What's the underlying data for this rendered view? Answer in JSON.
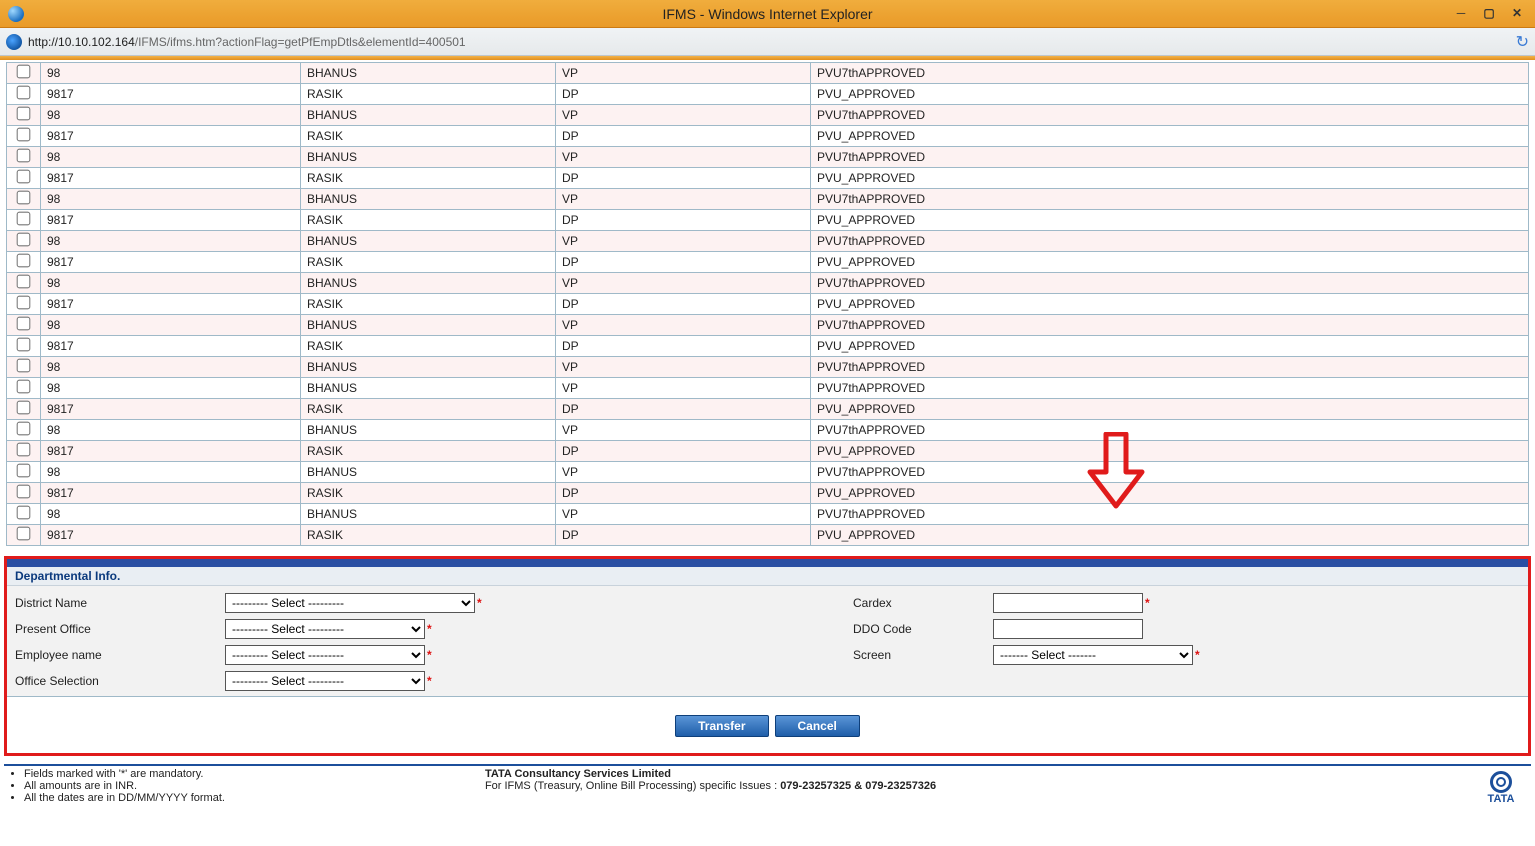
{
  "window": {
    "title": "IFMS - Windows Internet Explorer",
    "url_host": "http://10.10.102.164",
    "url_path": "/IFMS/ifms.htm?actionFlag=getPfEmpDtls&elementId=400501"
  },
  "table": {
    "rows": [
      {
        "c1": "98",
        "c2": "BHANUS",
        "c3": "VP",
        "c4": "PVU7thAPPROVED",
        "alt": true
      },
      {
        "c1": "9817",
        "c2": "RASIK",
        "c3": "DP",
        "c4": "PVU_APPROVED",
        "alt": false
      },
      {
        "c1": "98",
        "c2": "BHANUS",
        "c3": "VP",
        "c4": "PVU7thAPPROVED",
        "alt": true
      },
      {
        "c1": "9817",
        "c2": "RASIK",
        "c3": "DP",
        "c4": "PVU_APPROVED",
        "alt": false
      },
      {
        "c1": "98",
        "c2": "BHANUS",
        "c3": "VP",
        "c4": "PVU7thAPPROVED",
        "alt": true
      },
      {
        "c1": "9817",
        "c2": "RASIK",
        "c3": "DP",
        "c4": "PVU_APPROVED",
        "alt": false
      },
      {
        "c1": "98",
        "c2": "BHANUS",
        "c3": "VP",
        "c4": "PVU7thAPPROVED",
        "alt": true
      },
      {
        "c1": "9817",
        "c2": "RASIK",
        "c3": "DP",
        "c4": "PVU_APPROVED",
        "alt": false
      },
      {
        "c1": "98",
        "c2": "BHANUS",
        "c3": "VP",
        "c4": "PVU7thAPPROVED",
        "alt": true
      },
      {
        "c1": "9817",
        "c2": "RASIK",
        "c3": "DP",
        "c4": "PVU_APPROVED",
        "alt": false
      },
      {
        "c1": "98",
        "c2": "BHANUS",
        "c3": "VP",
        "c4": "PVU7thAPPROVED",
        "alt": true
      },
      {
        "c1": "9817",
        "c2": "RASIK",
        "c3": "DP",
        "c4": "PVU_APPROVED",
        "alt": false
      },
      {
        "c1": "98",
        "c2": "BHANUS",
        "c3": "VP",
        "c4": "PVU7thAPPROVED",
        "alt": true
      },
      {
        "c1": "9817",
        "c2": "RASIK",
        "c3": "DP",
        "c4": "PVU_APPROVED",
        "alt": false
      },
      {
        "c1": "98",
        "c2": "BHANUS",
        "c3": "VP",
        "c4": "PVU7thAPPROVED",
        "alt": true
      },
      {
        "c1": "98",
        "c2": "BHANUS",
        "c3": "VP",
        "c4": "PVU7thAPPROVED",
        "alt": false
      },
      {
        "c1": "9817",
        "c2": "RASIK",
        "c3": "DP",
        "c4": "PVU_APPROVED",
        "alt": true
      },
      {
        "c1": "98",
        "c2": "BHANUS",
        "c3": "VP",
        "c4": "PVU7thAPPROVED",
        "alt": false
      },
      {
        "c1": "9817",
        "c2": "RASIK",
        "c3": "DP",
        "c4": "PVU_APPROVED",
        "alt": true
      },
      {
        "c1": "98",
        "c2": "BHANUS",
        "c3": "VP",
        "c4": "PVU7thAPPROVED",
        "alt": false
      },
      {
        "c1": "9817",
        "c2": "RASIK",
        "c3": "DP",
        "c4": "PVU_APPROVED",
        "alt": true
      },
      {
        "c1": "98",
        "c2": "BHANUS",
        "c3": "VP",
        "c4": "PVU7thAPPROVED",
        "alt": false
      },
      {
        "c1": "9817",
        "c2": "RASIK",
        "c3": "DP",
        "c4": "PVU_APPROVED",
        "alt": true
      }
    ]
  },
  "dept": {
    "title": "Departmental Info.",
    "labels": {
      "district": "District Name",
      "present_office": "Present Office",
      "employee": "Employee name",
      "office_sel": "Office Selection",
      "cardex": "Cardex",
      "ddo": "DDO Code",
      "screen": "Screen"
    },
    "select_placeholder_wide": "--------- Select ---------",
    "select_placeholder_med": "--------- Select ---------",
    "select_placeholder_screen": "------- Select -------",
    "buttons": {
      "transfer": "Transfer",
      "cancel": "Cancel"
    }
  },
  "footer": {
    "notes": [
      "Fields marked with '*' are mandatory.",
      "All amounts are in INR.",
      "All the dates are in DD/MM/YYYY format."
    ],
    "org": "TATA Consultancy Services Limited",
    "line2_a": "For IFMS (Treasury, Online Bill Processing) specific Issues : ",
    "line2_phones": "079-23257325 & 079-23257326",
    "logo_text": "TATA"
  }
}
